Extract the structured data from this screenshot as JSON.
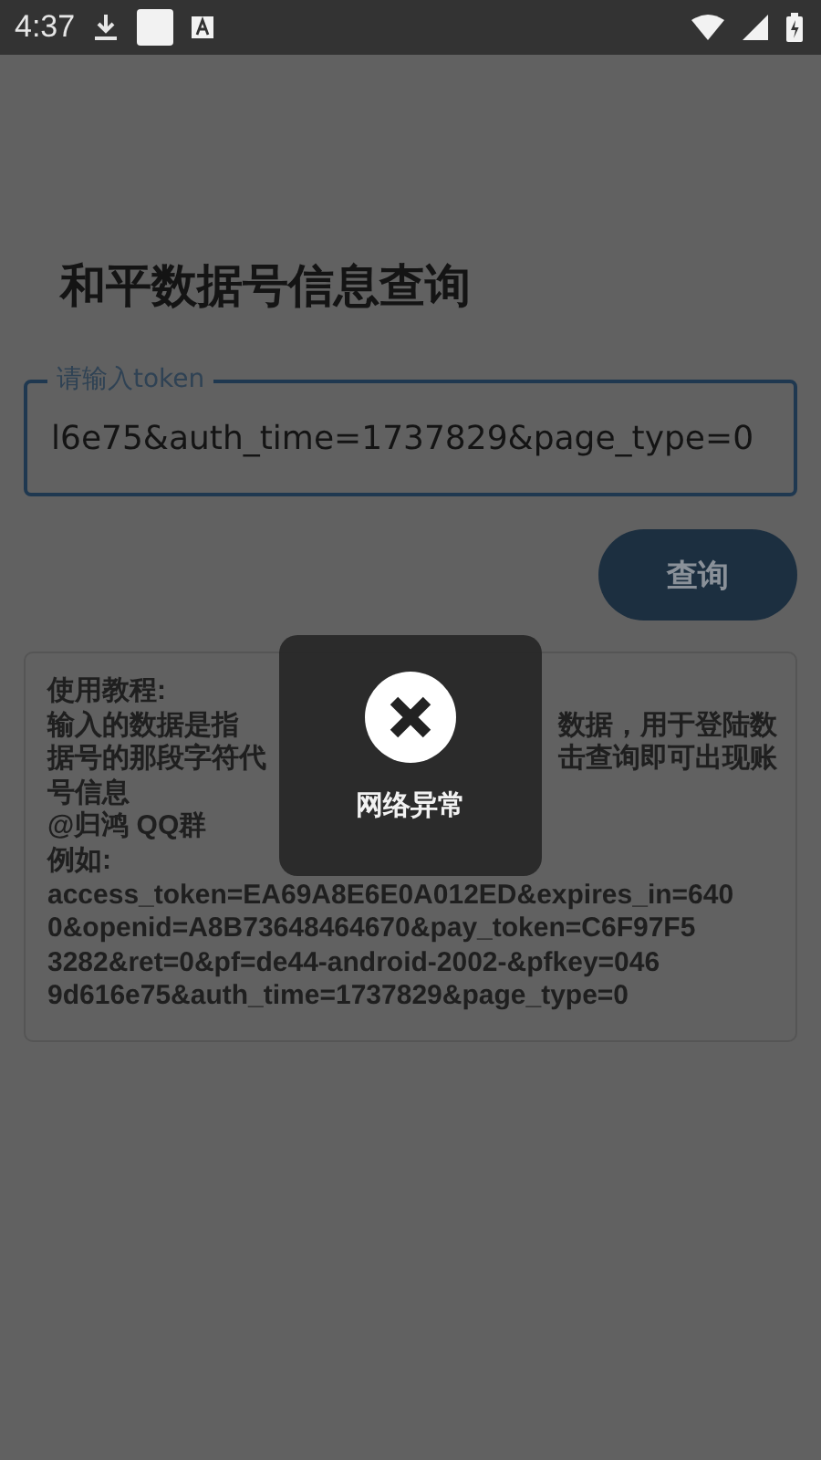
{
  "status_bar": {
    "time": "4:37"
  },
  "title": "和平数据号信息查询",
  "token_field": {
    "label": "请输入token",
    "value": "l6e75&auth_time=1737829&page_type=0",
    "focused": true
  },
  "query_button": "查询",
  "tutorial": {
    "lines": [
      {
        "parts": [
          "使用教程:"
        ]
      },
      {
        "parts": [
          "输入的数据是指",
          "数据，用于登陆数"
        ]
      },
      {
        "parts": [
          "据号的那段字符代",
          "击查询即可出现账"
        ]
      },
      {
        "parts": [
          "号信息"
        ]
      },
      {
        "parts": [
          "@归鸿  QQ群"
        ]
      },
      {
        "parts": [
          "例如:"
        ]
      },
      {
        "parts": [
          "access_token=EA69A8E6E0A012ED&expires_in=640"
        ]
      },
      {
        "parts": [
          "0&openid=A8B73648464670&pay_token=C6F97F5"
        ]
      },
      {
        "parts": [
          "3282&ret=0&pf=de44-android-2002-&pfkey=046"
        ]
      },
      {
        "parts": [
          "9d616e75&auth_time=1737829&page_type=0"
        ]
      }
    ]
  },
  "toast": {
    "message": "网络异常"
  }
}
